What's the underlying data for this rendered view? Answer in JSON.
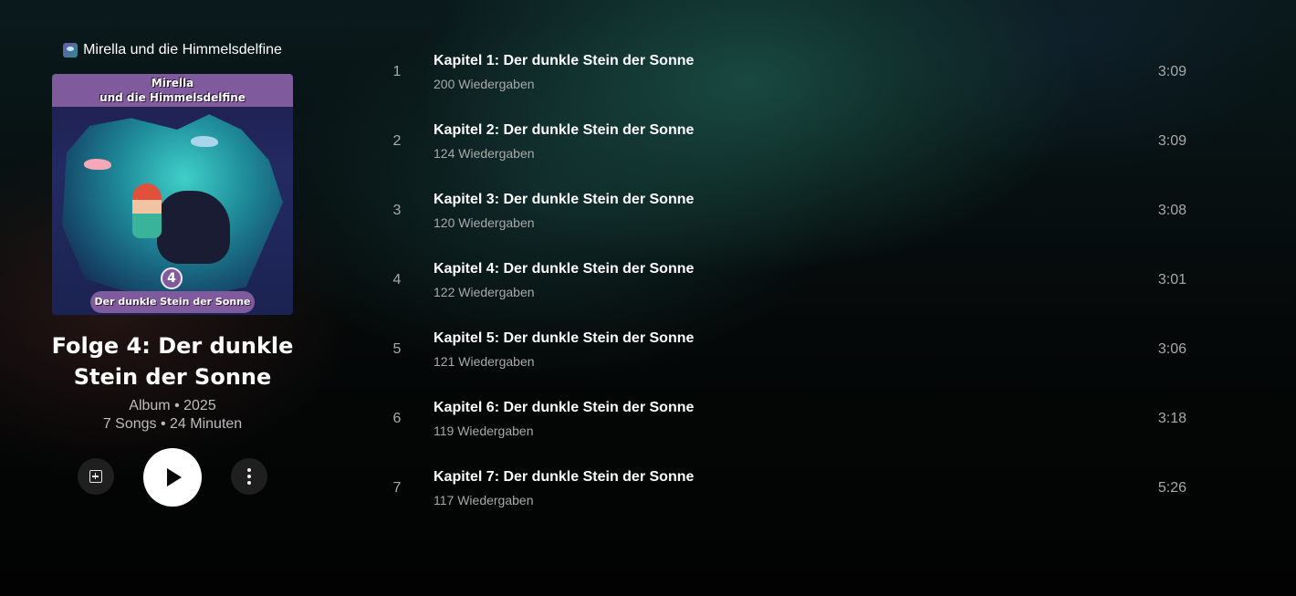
{
  "album": {
    "artist": "Mirella und die Himmelsdelfine",
    "title": "Folge 4: Der dunkle Stein der Sonne",
    "meta_line1": "Album • 2025",
    "meta_line2": "7 Songs • 24 Minuten",
    "cover": {
      "banner_line1": "Mirella",
      "banner_line2": "und die Himmelsdelfine",
      "episode_number": "4",
      "bottom_text": "Der dunkle Stein der Sonne"
    }
  },
  "controls": {
    "save_icon": "library-add-icon",
    "play_icon": "play-icon",
    "more_icon": "more-vertical-icon"
  },
  "tracks": [
    {
      "number": "1",
      "title": "Kapitel 1: Der dunkle Stein der Sonne",
      "plays": "200 Wiedergaben",
      "duration": "3:09"
    },
    {
      "number": "2",
      "title": "Kapitel 2: Der dunkle Stein der Sonne",
      "plays": "124 Wiedergaben",
      "duration": "3:09"
    },
    {
      "number": "3",
      "title": "Kapitel 3: Der dunkle Stein der Sonne",
      "plays": "120 Wiedergaben",
      "duration": "3:08"
    },
    {
      "number": "4",
      "title": "Kapitel 4: Der dunkle Stein der Sonne",
      "plays": "122 Wiedergaben",
      "duration": "3:01"
    },
    {
      "number": "5",
      "title": "Kapitel 5: Der dunkle Stein der Sonne",
      "plays": "121 Wiedergaben",
      "duration": "3:06"
    },
    {
      "number": "6",
      "title": "Kapitel 6: Der dunkle Stein der Sonne",
      "plays": "119 Wiedergaben",
      "duration": "3:18"
    },
    {
      "number": "7",
      "title": "Kapitel 7: Der dunkle Stein der Sonne",
      "plays": "117 Wiedergaben",
      "duration": "5:26"
    }
  ],
  "colors": {
    "background": "#030303",
    "accent_teal": "#1e5a4e",
    "muted_text": "#a9a9a9",
    "cover_purple": "#7f5a9c"
  }
}
